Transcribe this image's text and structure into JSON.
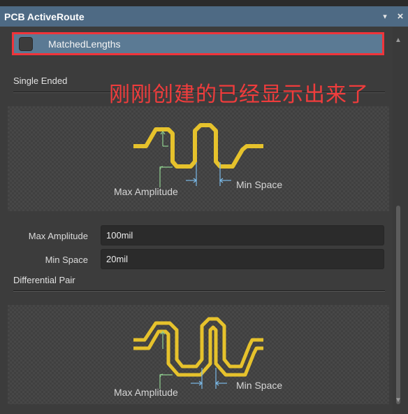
{
  "window": {
    "title": "PCB ActiveRoute",
    "menu_glyph": "▾",
    "close_glyph": "×"
  },
  "profile": {
    "checked": false,
    "label": "MatchedLengths"
  },
  "annotation": "刚刚创建的已经显示出来了",
  "single_ended": {
    "section_label": "Single Ended",
    "diagram_labels": {
      "amplitude": "Max Amplitude",
      "space": "Min Space"
    }
  },
  "fields": {
    "max_amplitude": {
      "label": "Max Amplitude",
      "value": "100mil"
    },
    "min_space": {
      "label": "Min Space",
      "value": "20mil"
    }
  },
  "differential_pair": {
    "section_label": "Differential Pair",
    "diagram_labels": {
      "amplitude": "Max Amplitude",
      "space": "Min Space"
    }
  },
  "colors": {
    "titlebar": "#4e6a84",
    "highlight_border": "#f0343a",
    "trace": "#e6c22c",
    "dim_arrow_green": "#8fd08f",
    "dim_arrow_blue": "#7ab8e6"
  },
  "icons": {
    "menu": "chevron-down-icon",
    "close": "close-icon",
    "scroll_up": "scroll-up-arrow-icon",
    "scroll_down": "scroll-down-arrow-icon"
  }
}
